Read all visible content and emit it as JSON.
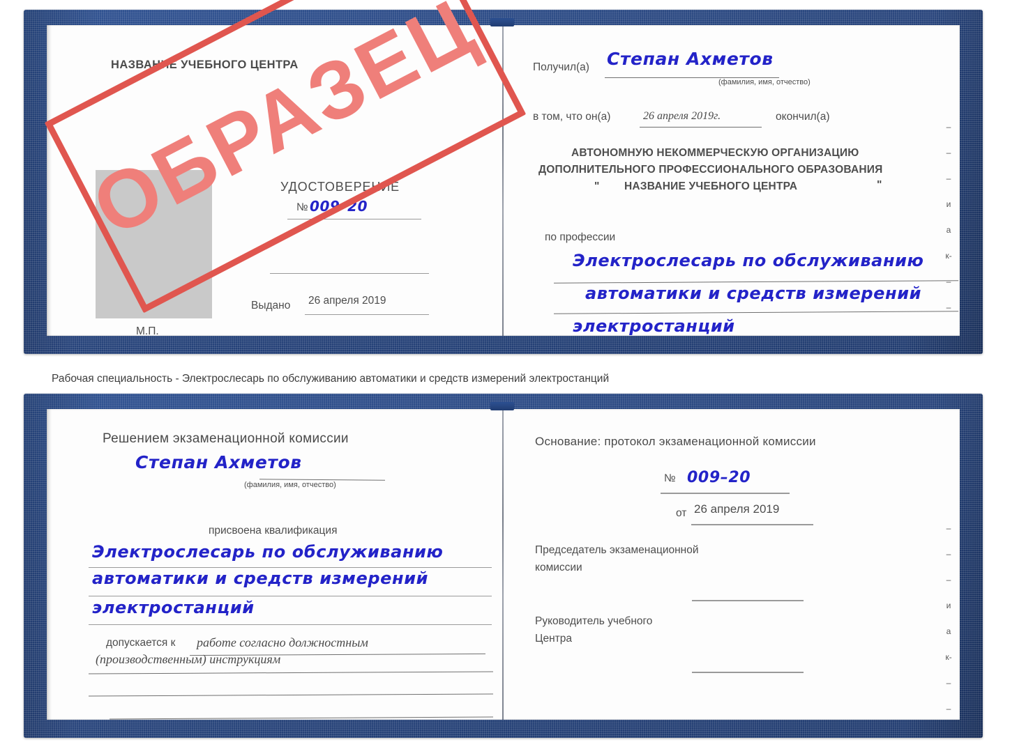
{
  "document": {
    "type": "certificate-sample-scan",
    "watermark": {
      "text": "ОБРАЗЕЦ",
      "color": "#ef7f7a",
      "border_color": "#e0564f"
    },
    "cover_color": "#2d5091",
    "handwriting_color": "#2323c8"
  },
  "top_certificate": {
    "left_page": {
      "header": "НАЗВАНИЕ УЧЕБНОГО ЦЕНТРА",
      "title": "УДОСТОВЕРЕНИЕ",
      "number_label": "№",
      "number_value": "009–20",
      "issued_label": "Выдано",
      "issued_value": "26 апреля 2019",
      "seal_label": "М.П.",
      "photo_placeholder": "photo-box"
    },
    "right_page": {
      "received_label": "Получил(а)",
      "received_value": "Степан Ахметов",
      "fio_hint": "(фамилия, имя, отчество)",
      "in_that_label": "в том, что он(а)",
      "in_that_value": "26 апреля 2019г.",
      "finished_label": "окончил(а)",
      "org_line1": "АВТОНОМНУЮ НЕКОММЕРЧЕСКУЮ ОРГАНИЗАЦИЮ",
      "org_line2": "ДОПОЛНИТЕЛЬНОГО ПРОФЕССИОНАЛЬНОГО ОБРАЗОВАНИЯ",
      "org_quote_open": "\"",
      "org_line3": "НАЗВАНИЕ УЧЕБНОГО ЦЕНТРА",
      "org_quote_close": "\"",
      "profession_label": "по профессии",
      "profession_line1": "Электрослесарь по обслуживанию",
      "profession_line2": "автоматики и средств измерений",
      "profession_line3": "электростанций",
      "edge_marks": [
        "–",
        "–",
        "–",
        "и",
        "а",
        "к-",
        "–",
        "–",
        "–",
        "–"
      ]
    }
  },
  "caption": "Рабочая специальность - Электрослесарь по обслуживанию автоматики и средств измерений электростанций",
  "bottom_certificate": {
    "left_page": {
      "decision_title": "Решением экзаменационной комиссии",
      "name_value": "Степан Ахметов",
      "fio_hint": "(фамилия, имя, отчество)",
      "qualification_label": "присвоена квалификация",
      "qualification_line1": "Электрослесарь по обслуживанию",
      "qualification_line2": "автоматики и средств измерений",
      "qualification_line3": "электростанций",
      "admitted_label": "допускается к",
      "admitted_value_line1": "работе согласно должностным",
      "admitted_value_line2": "(производственным) инструкциям"
    },
    "right_page": {
      "basis_label": "Основание: протокол экзаменационной комиссии",
      "number_label": "№",
      "number_value": "009–20",
      "date_label": "от",
      "date_value": "26 апреля 2019",
      "chairman_line1": "Председатель экзаменационной",
      "chairman_line2": "комиссии",
      "head_line1": "Руководитель учебного",
      "head_line2": "Центра",
      "edge_marks": [
        "–",
        "–",
        "–",
        "и",
        "а",
        "к-",
        "–",
        "–",
        "–",
        "–"
      ]
    }
  }
}
